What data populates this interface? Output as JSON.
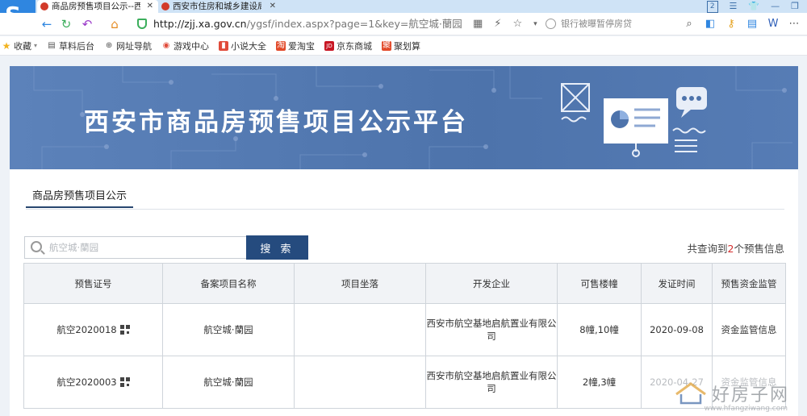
{
  "browser": {
    "tabs": [
      {
        "title": "商品房预售项目公示--西",
        "active": true
      },
      {
        "title": "西安市住房和城乡建设局",
        "active": false
      }
    ],
    "url_host": "http://zjj.xa.gov.cn",
    "url_path": "/ygsf/index.aspx?page=1&key=航空城·蘭园",
    "search_engine_text": "银行被曝暂停房贷",
    "window_badge": "2"
  },
  "bookmarks": [
    {
      "label": "收藏",
      "icon": "star-icon",
      "color": "#f2b320"
    },
    {
      "label": "草料后台",
      "icon": "page-icon",
      "color": "#555555"
    },
    {
      "label": "网址导航",
      "icon": "globe-icon",
      "color": "#555555"
    },
    {
      "label": "游戏中心",
      "icon": "game-icon",
      "color": "#e04b3a"
    },
    {
      "label": "小说大全",
      "icon": "book-icon",
      "color": "#e04b3a"
    },
    {
      "label": "爱淘宝",
      "icon": "taobao-icon",
      "color": "#e24a2a"
    },
    {
      "label": "京东商城",
      "icon": "jd-icon",
      "color": "#c81623"
    },
    {
      "label": "聚划算",
      "icon": "ju-icon",
      "color": "#e24a2a"
    }
  ],
  "banner": {
    "title": "西安市商品房预售项目公示平台"
  },
  "section": {
    "tab_label": "商品房预售项目公示"
  },
  "search": {
    "placeholder": "航空城·蘭园",
    "button_label": "搜 索",
    "result_prefix": "共查询到",
    "result_count": "2",
    "result_suffix": "个预售信息"
  },
  "table": {
    "headers": [
      "预售证号",
      "备案项目名称",
      "项目坐落",
      "开发企业",
      "可售楼幢",
      "发证时间",
      "预售资金监管"
    ],
    "rows": [
      {
        "cert": "航空2020018",
        "project": "航空城·蘭园",
        "location": "",
        "developer": "西安市航空基地启航置业有限公司",
        "buildings": "8幢,10幢",
        "date": "2020-09-08",
        "supervision": "资金监管信息"
      },
      {
        "cert": "航空2020003",
        "project": "航空城·蘭园",
        "location": "",
        "developer": "西安市航空基地启航置业有限公司",
        "buildings": "2幢,3幢",
        "date": "2020-04-27",
        "supervision": "资金监管信息"
      }
    ]
  },
  "watermark": {
    "text": "好房子网",
    "url": "www.hfangziwang.com"
  },
  "colors": {
    "banner": "#4d73ab",
    "button": "#254b7e",
    "count_accent": "#d42b2b"
  }
}
